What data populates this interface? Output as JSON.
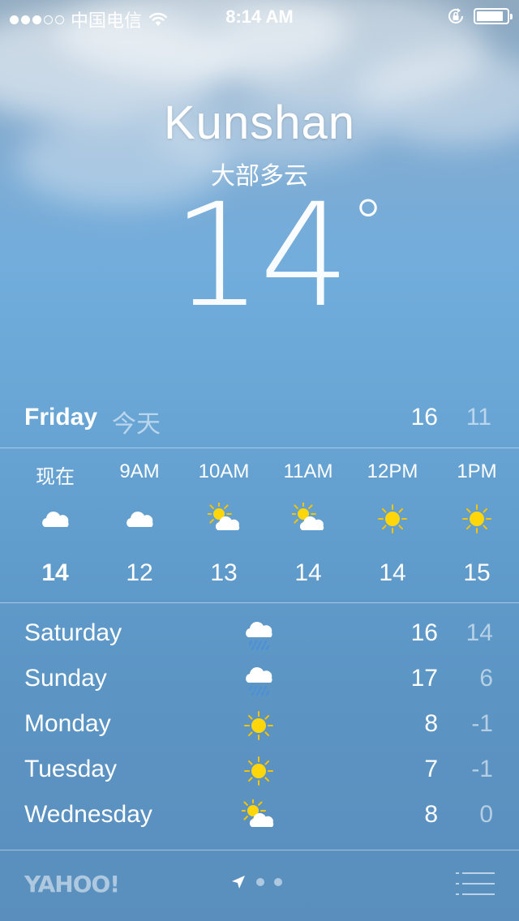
{
  "status_bar": {
    "signal_dots": [
      true,
      true,
      true,
      false,
      false
    ],
    "carrier": "中国电信",
    "time": "8:14 AM",
    "battery_level": 0.88
  },
  "current": {
    "city": "Kunshan",
    "condition": "大部多云",
    "temperature": "14",
    "degree_symbol": "°"
  },
  "today": {
    "day": "Friday",
    "label": "今天",
    "high": "16",
    "low": "11"
  },
  "hourly": [
    {
      "time": "现在",
      "icon": "cloud-icon",
      "temp": "14",
      "bold": true,
      "cjk": true
    },
    {
      "time": "9AM",
      "icon": "cloud-icon",
      "temp": "12",
      "bold": false,
      "cjk": false
    },
    {
      "time": "10AM",
      "icon": "partly-sunny-icon",
      "temp": "13",
      "bold": false,
      "cjk": false
    },
    {
      "time": "11AM",
      "icon": "partly-sunny-icon",
      "temp": "14",
      "bold": false,
      "cjk": false
    },
    {
      "time": "12PM",
      "icon": "sun-icon",
      "temp": "14",
      "bold": false,
      "cjk": false
    },
    {
      "time": "1PM",
      "icon": "sun-icon",
      "temp": "15",
      "bold": false,
      "cjk": false
    }
  ],
  "daily": [
    {
      "day": "Saturday",
      "icon": "rain-cloud-icon",
      "high": "16",
      "low": "14"
    },
    {
      "day": "Sunday",
      "icon": "rain-cloud-icon",
      "high": "17",
      "low": "6"
    },
    {
      "day": "Monday",
      "icon": "sun-icon",
      "high": "8",
      "low": "-1"
    },
    {
      "day": "Tuesday",
      "icon": "sun-icon",
      "high": "7",
      "low": "-1"
    },
    {
      "day": "Wednesday",
      "icon": "partly-sunny-icon",
      "high": "8",
      "low": "0"
    }
  ],
  "footer": {
    "provider": "YAHOO!",
    "page_count": 2
  },
  "colors": {
    "sun": "#ffd60a",
    "sun_ray": "#f5c400",
    "cloud": "#ffffff",
    "rain": "#4a8fd8",
    "secondary_text": "rgba(255,255,255,0.55)"
  }
}
